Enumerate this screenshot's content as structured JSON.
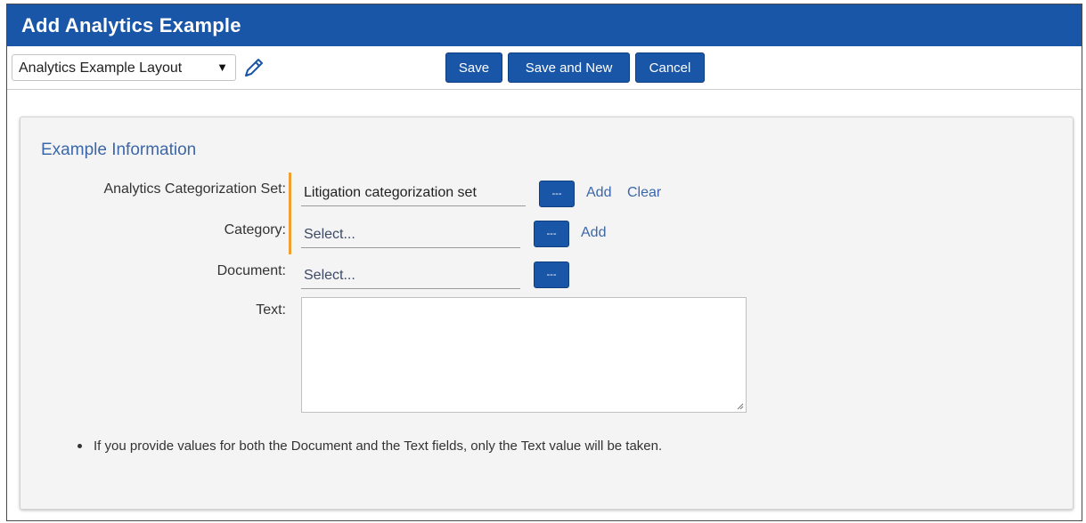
{
  "window": {
    "title": "Add Analytics Example"
  },
  "toolbar": {
    "layout_selected": "Analytics Example Layout",
    "save_label": "Save",
    "save_new_label": "Save and New",
    "cancel_label": "Cancel"
  },
  "section": {
    "title": "Example Information"
  },
  "fields": {
    "categorization_set": {
      "label": "Analytics Categorization Set:",
      "value": "Litigation categorization set",
      "picker_label": "---",
      "add_label": "Add",
      "clear_label": "Clear"
    },
    "category": {
      "label": "Category:",
      "placeholder": "Select...",
      "picker_label": "---",
      "add_label": "Add"
    },
    "document": {
      "label": "Document:",
      "placeholder": "Select...",
      "picker_label": "---"
    },
    "text": {
      "label": "Text:",
      "value": ""
    }
  },
  "note": "If you provide values for both the Document and the Text fields, only the Text value will be taken.",
  "icons": {
    "edit": "pencil-icon",
    "dropdown": "caret-down-icon"
  },
  "colors": {
    "header_blue": "#1a56a8",
    "section_title": "#3c67a8",
    "required_marker": "#f0a030"
  }
}
